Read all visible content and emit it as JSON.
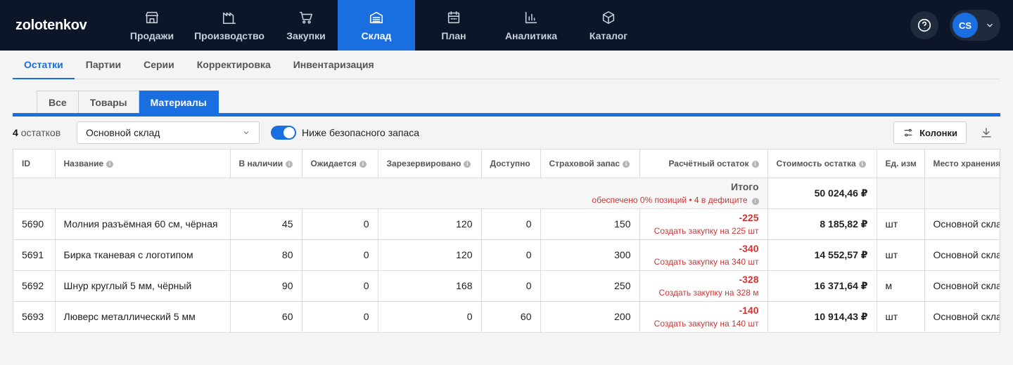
{
  "app": {
    "logo": "zolotenkov"
  },
  "nav": [
    {
      "label": "Продажи",
      "icon": "store-icon",
      "active": false
    },
    {
      "label": "Производство",
      "icon": "factory-icon",
      "active": false
    },
    {
      "label": "Закупки",
      "icon": "cart-icon",
      "active": false
    },
    {
      "label": "Склад",
      "icon": "warehouse-icon",
      "active": true
    },
    {
      "label": "План",
      "icon": "calendar-icon",
      "active": false
    },
    {
      "label": "Аналитика",
      "icon": "bar-chart-icon",
      "active": false
    },
    {
      "label": "Каталог",
      "icon": "box-icon",
      "active": false
    }
  ],
  "user": {
    "initials": "CS"
  },
  "subtabs": [
    "Остатки",
    "Партии",
    "Серии",
    "Корректировка",
    "Инвентаризация"
  ],
  "segments": [
    "Все",
    "Товары",
    "Материалы"
  ],
  "toolbar": {
    "count": "4",
    "count_label": "остатков",
    "warehouse": "Основной склад",
    "toggle_label": "Ниже безопасного запаса",
    "toggle_on": true,
    "columns_label": "Колонки"
  },
  "table": {
    "headers": {
      "id": "ID",
      "name": "Название",
      "in_stock": "В наличии",
      "expected": "Ожидается",
      "reserved": "Зарезервировано",
      "available": "Доступно",
      "safety": "Страховой запас",
      "calc": "Расчётный остаток",
      "value": "Стоимость остатка",
      "unit": "Ед. изм",
      "location": "Место хранения"
    },
    "total": {
      "label": "Итого",
      "sub": "обеспечено 0% позиций • 4 в дефиците",
      "value": "50 024,46 ₽"
    },
    "rows": [
      {
        "id": "5690",
        "name": "Молния разъёмная 60 см, чёрная",
        "in_stock": "45",
        "expected": "0",
        "reserved": "120",
        "available": "0",
        "safety": "150",
        "calc": "-225",
        "calc_action": "Создать закупку на 225 шт",
        "value": "8 185,82 ₽",
        "unit": "шт",
        "location": "Основной склад"
      },
      {
        "id": "5691",
        "name": "Бирка тканевая с логотипом",
        "in_stock": "80",
        "expected": "0",
        "reserved": "120",
        "available": "0",
        "safety": "300",
        "calc": "-340",
        "calc_action": "Создать закупку на 340 шт",
        "value": "14 552,57 ₽",
        "unit": "шт",
        "location": "Основной склад"
      },
      {
        "id": "5692",
        "name": "Шнур круглый 5 мм, чёрный",
        "in_stock": "90",
        "expected": "0",
        "reserved": "168",
        "available": "0",
        "safety": "250",
        "calc": "-328",
        "calc_action": "Создать закупку на 328 м",
        "value": "16 371,64 ₽",
        "unit": "м",
        "location": "Основной склад"
      },
      {
        "id": "5693",
        "name": "Люверс металлический 5 мм",
        "in_stock": "60",
        "expected": "0",
        "reserved": "0",
        "available": "60",
        "safety": "200",
        "calc": "-140",
        "calc_action": "Создать закупку на 140 шт",
        "value": "10 914,43 ₽",
        "unit": "шт",
        "location": "Основной склад"
      }
    ]
  },
  "colors": {
    "accent": "#1a6fe0",
    "topbar": "#0c1628",
    "deficit": "#d13434"
  }
}
